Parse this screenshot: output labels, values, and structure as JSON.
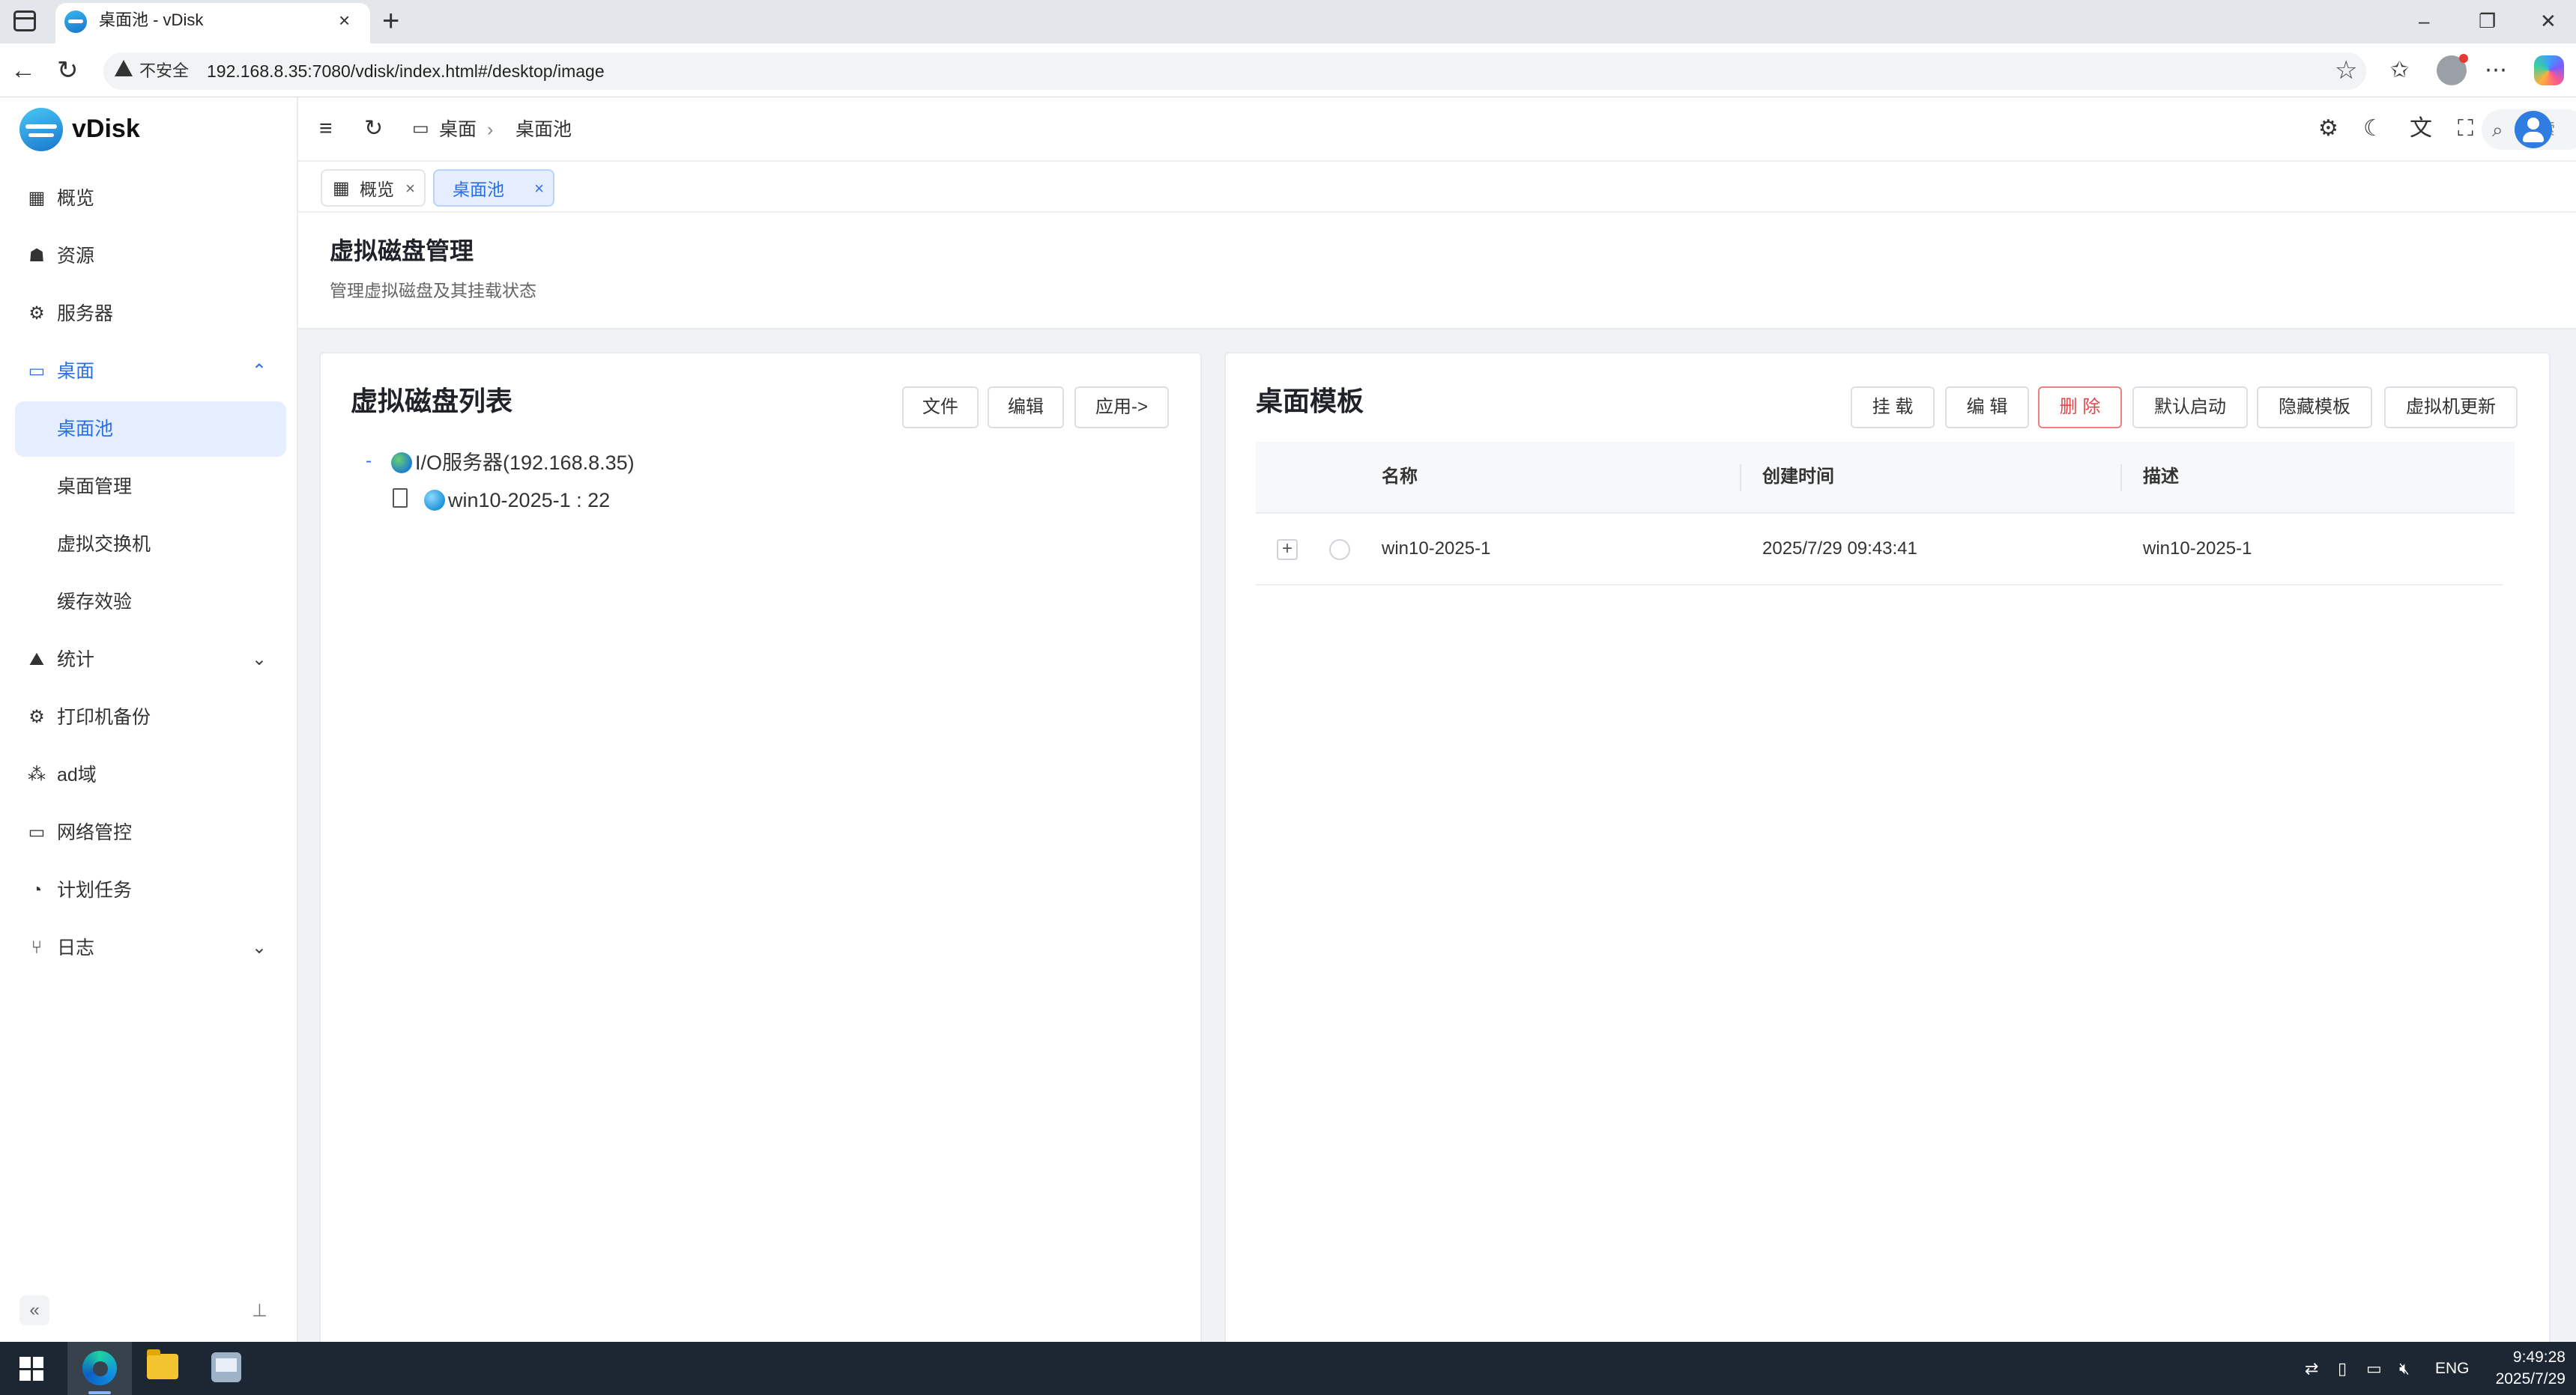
{
  "browser": {
    "tab_title": "桌面池 - vDisk",
    "tab_close": "×",
    "new_tab": "+",
    "security_label": "不安全",
    "url": "192.168.8.35:7080/vdisk/index.html#/desktop/image"
  },
  "app": {
    "brand": "vDisk"
  },
  "sidebar": {
    "items": [
      {
        "label": "概览",
        "icon": "dashboard-icon"
      },
      {
        "label": "资源",
        "icon": "resource-icon"
      },
      {
        "label": "服务器",
        "icon": "server-icon"
      },
      {
        "label": "桌面",
        "icon": "desktop-icon",
        "expanded": true
      },
      {
        "label": "桌面池",
        "active": true
      },
      {
        "label": "桌面管理"
      },
      {
        "label": "虚拟交换机"
      },
      {
        "label": "缓存效验"
      },
      {
        "label": "统计",
        "icon": "stats-icon"
      },
      {
        "label": "打印机备份",
        "icon": "printer-icon"
      },
      {
        "label": "ad域",
        "icon": "ad-domain-icon"
      },
      {
        "label": "网络管控",
        "icon": "network-icon"
      },
      {
        "label": "计划任务",
        "icon": "task-icon"
      },
      {
        "label": "日志",
        "icon": "log-icon"
      }
    ]
  },
  "header": {
    "breadcrumb": [
      "桌面",
      "桌面池"
    ],
    "search_label": "搜索"
  },
  "tabs": [
    {
      "label": "概览",
      "close": "×"
    },
    {
      "label": "桌面池",
      "close": "×",
      "active": true
    }
  ],
  "page": {
    "title": "虚拟磁盘管理",
    "subtitle": "管理虚拟磁盘及其挂载状态"
  },
  "disk_list": {
    "title": "虚拟磁盘列表",
    "buttons": [
      "文件",
      "编辑",
      "应用->"
    ],
    "tree": {
      "toggle": "-",
      "server": "I/O服务器(192.168.8.35)",
      "child": "win10-2025-1 : 22"
    }
  },
  "templates": {
    "title": "桌面模板",
    "buttons": [
      "挂 载",
      "编 辑",
      "删 除",
      "默认启动",
      "隐藏模板",
      "虚拟机更新"
    ],
    "columns": [
      "名称",
      "创建时间",
      "描述"
    ],
    "rows": [
      {
        "name": "win10-2025-1",
        "created": "2025/7/29 09:43:41",
        "desc": "win10-2025-1",
        "expand": "+"
      }
    ]
  },
  "taskbar": {
    "lang": "ENG",
    "time": "9:49:28",
    "date": "2025/7/29"
  },
  "colors": {
    "accent": "#2a6fe8",
    "active_bg": "#e4eefe",
    "danger": "#e04848"
  }
}
